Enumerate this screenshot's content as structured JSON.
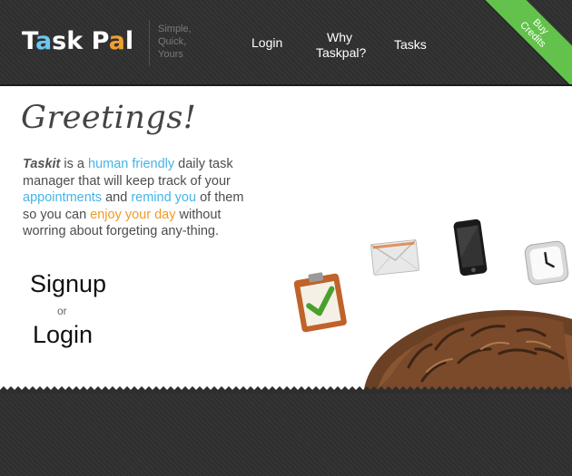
{
  "brand": {
    "logo_letters": [
      "T",
      "a",
      "s",
      "k",
      " P",
      "a",
      "l"
    ],
    "tagline": [
      "Simple,",
      "Quick,",
      "Yours"
    ]
  },
  "nav": {
    "login": "Login",
    "why_line1": "Why",
    "why_line2": "Taskpal?",
    "tasks": "Tasks"
  },
  "ribbon": {
    "line1": "Buy",
    "line2": "Credits"
  },
  "hero": {
    "title": "Greetings!",
    "intro": {
      "brand": "Taskit",
      "t1": " is a ",
      "hl1": "human friendly",
      "t2": " daily task manager that will keep track of your ",
      "hl2": "appointments",
      "t3": " and ",
      "hl3": "remind you",
      "t4": " of them so you can ",
      "hl4": "enjoy your day",
      "t5": " without worring about forgeting any-thing."
    },
    "signup": "Signup",
    "or": "or",
    "login": "Login"
  },
  "colors": {
    "accent_blue": "#45b4e8",
    "accent_orange": "#f09a28",
    "ribbon_green": "#63c24b",
    "header_dark": "#2e2e2e"
  },
  "icons": [
    "clipboard-check-icon",
    "envelope-icon",
    "smartphone-icon",
    "clock-icon"
  ]
}
